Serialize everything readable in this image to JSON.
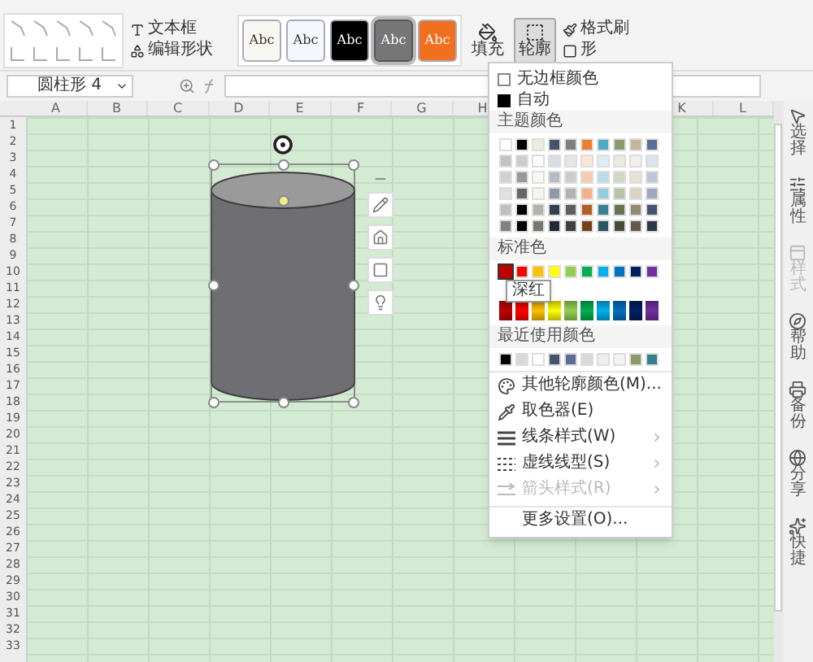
{
  "ribbon": {
    "text_box": "文本框",
    "edit_shape": "编辑形状",
    "style_presets": [
      {
        "label": "Abc",
        "color": "#f8f6f0",
        "selected": false
      },
      {
        "label": "Abc",
        "color": "#f4f7fb",
        "selected": false
      },
      {
        "label": "Abc",
        "color": "#000000",
        "selected": false
      },
      {
        "label": "Abc",
        "color": "#767676",
        "selected": true
      },
      {
        "label": "Abc",
        "color": "#f07020",
        "selected": false
      }
    ],
    "fill": "填充",
    "outline": {
      "label": "轮廓",
      "selected": true
    },
    "format_painter": "格式刷",
    "shape_effects": "形"
  },
  "name_box": "圆柱形 4",
  "column_headers": [
    "A",
    "B",
    "C",
    "D",
    "E",
    "F",
    "G",
    "H"
  ],
  "column_headers_right": [
    "K",
    "L"
  ],
  "row_numbers": [
    "1",
    "2",
    "3",
    "4",
    "5",
    "6",
    "7",
    "8",
    "9",
    "10",
    "11",
    "12",
    "13",
    "14",
    "15",
    "16",
    "17",
    "18",
    "19",
    "20",
    "21",
    "22",
    "23",
    "24",
    "25",
    "26",
    "27",
    "28",
    "29",
    "30",
    "31",
    "32",
    "33"
  ],
  "outline_menu": {
    "no_border": "无边框颜色",
    "auto": "自动",
    "theme_title": "主题颜色",
    "theme_colors": [
      {
        "color": "#ffffff"
      },
      {
        "color": "#000000"
      },
      {
        "color": "#eeece1"
      },
      {
        "color": "#44546a"
      },
      {
        "color": "#7f7f7f"
      },
      {
        "color": "#ed7d31"
      },
      {
        "color": "#4bacc6"
      },
      {
        "color": "#8b9a6a"
      },
      {
        "color": "#c4b69a"
      },
      {
        "color": "#5a6e96"
      }
    ],
    "standard_title": "标准色",
    "standard_colors": [
      {
        "color": "#c00000",
        "selected": true
      },
      {
        "color": "#ff0000",
        "selected": false
      },
      {
        "color": "#ffc000",
        "selected": false
      },
      {
        "color": "#ffff00",
        "selected": false
      },
      {
        "color": "#92d050",
        "selected": false
      },
      {
        "color": "#00b050",
        "selected": false
      },
      {
        "color": "#00b0f0",
        "selected": false
      },
      {
        "color": "#0070c0",
        "selected": false
      },
      {
        "color": "#002060",
        "selected": false
      },
      {
        "color": "#7030a0",
        "selected": false
      }
    ],
    "tooltip": "深红",
    "recent_title": "最近使用颜色",
    "recent_colors": [
      {
        "color": "#000000"
      },
      {
        "color": "#d9d9d9"
      },
      {
        "color": "#ffffff"
      },
      {
        "color": "#44546a"
      },
      {
        "color": "#5a6e96"
      },
      {
        "color": "#d8d8d8"
      },
      {
        "color": "#eeeeee"
      },
      {
        "color": "#f2f2f2"
      },
      {
        "color": "#8b9a6a"
      },
      {
        "color": "#317f8f"
      }
    ],
    "items": [
      {
        "kind": "palette",
        "label": "其他轮廓颜色(M)...",
        "disabled": false,
        "submenu": false
      },
      {
        "kind": "eyedropper",
        "label": "取色器(E)",
        "disabled": false,
        "submenu": false
      },
      {
        "kind": "lines",
        "label": "线条样式(W)",
        "disabled": false,
        "submenu": true
      },
      {
        "kind": "dashes",
        "label": "虚线线型(S)",
        "disabled": false,
        "submenu": true
      },
      {
        "kind": "arrows",
        "label": "箭头样式(R)",
        "disabled": true,
        "submenu": true
      },
      {
        "kind": "plain",
        "label": "更多设置(O)...",
        "disabled": false,
        "submenu": false
      }
    ]
  },
  "right_sidebar": [
    {
      "kind": "pointer",
      "label": "选择",
      "disabled": false
    },
    {
      "kind": "sliders",
      "label": "属性",
      "disabled": false
    },
    {
      "kind": "layout",
      "label": "样式",
      "disabled": true
    },
    {
      "kind": "compass",
      "label": "帮助",
      "disabled": false
    },
    {
      "kind": "printer",
      "label": "备份",
      "disabled": false
    },
    {
      "kind": "globe",
      "label": "分享",
      "disabled": false
    },
    {
      "kind": "sparkle",
      "label": "快捷",
      "disabled": false
    }
  ]
}
